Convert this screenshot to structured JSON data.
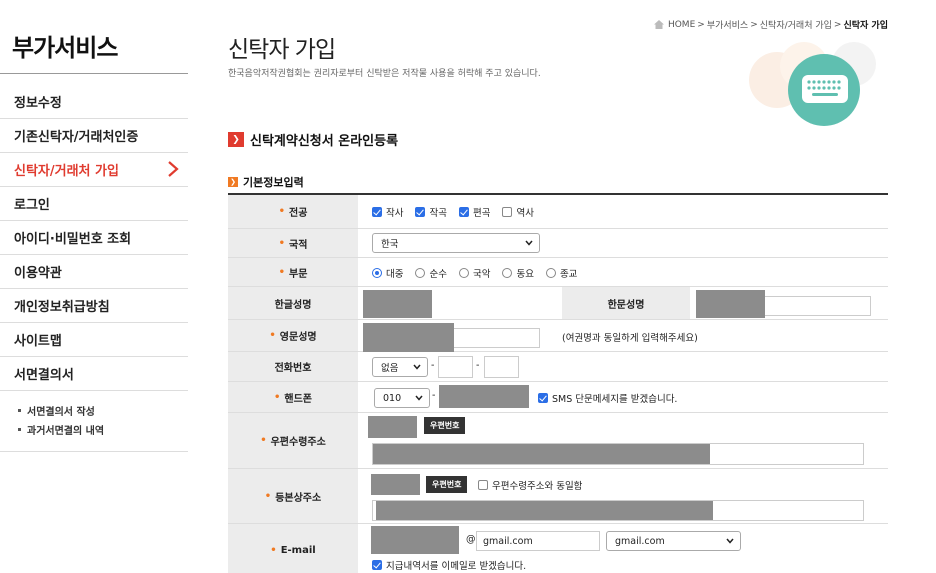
{
  "sidebar": {
    "title": "부가서비스",
    "items": [
      {
        "label": "정보수정"
      },
      {
        "label": "기존신탁자/거래처인증"
      },
      {
        "label": "신탁자/거래처 가입"
      },
      {
        "label": "로그인"
      },
      {
        "label": "아이디·비밀번호 조회"
      },
      {
        "label": "이용약관"
      },
      {
        "label": "개인정보취급방침"
      },
      {
        "label": "사이트맵"
      },
      {
        "label": "서면결의서"
      }
    ],
    "active_index": 2,
    "sub_items": [
      {
        "label": "서면결의서 작성"
      },
      {
        "label": "과거서면결의 내역"
      }
    ]
  },
  "breadcrumb": {
    "home": "HOME",
    "sep": ">",
    "level1": "부가서비스",
    "level2": "신탁자/거래처 가입",
    "current": "신탁자 가입"
  },
  "page": {
    "title": "신탁자 가입",
    "description": "한국음악저작권협회는 권리자로부터 신탁받은 저작물 사용을 허락해 주고 있습니다."
  },
  "section": {
    "title": "신탁계약신청서 온라인등록",
    "subtitle": "기본정보입력"
  },
  "form": {
    "genre": {
      "label": "전공",
      "options": [
        {
          "label": "작사",
          "checked": true
        },
        {
          "label": "작곡",
          "checked": true
        },
        {
          "label": "편곡",
          "checked": true
        },
        {
          "label": "역사",
          "checked": false
        }
      ]
    },
    "nationality": {
      "label": "국적",
      "value": "한국"
    },
    "category": {
      "label": "부문",
      "options": [
        {
          "label": "대중",
          "selected": true
        },
        {
          "label": "순수",
          "selected": false
        },
        {
          "label": "국악",
          "selected": false
        },
        {
          "label": "동요",
          "selected": false
        },
        {
          "label": "종교",
          "selected": false
        }
      ]
    },
    "korean_name": {
      "label": "한글성명"
    },
    "hanja_name": {
      "label": "한문성명"
    },
    "english_name": {
      "label": "영문성명",
      "note": "(여권명과 동일하게 입력해주세요)"
    },
    "phone": {
      "label": "전화번호",
      "prefix": "없음",
      "dash": "-"
    },
    "mobile": {
      "label": "핸드폰",
      "prefix": "010",
      "dash": "-",
      "sms_label": "SMS 단문메세지를 받겠습니다.",
      "sms_checked": true
    },
    "mail_address": {
      "label": "우편수령주소",
      "button": "우편번호"
    },
    "registered_address": {
      "label": "등본상주소",
      "button": "우편번호",
      "same_label": "우편수령주소와 동일함",
      "same_checked": false
    },
    "email": {
      "label": "E-mail",
      "at": "@",
      "domain_value": "gmail.com",
      "domain_select": "gmail.com",
      "statement_label": "지급내역서를 이메일로 받겠습니다.",
      "statement_checked": true
    }
  },
  "colors": {
    "accent_red": "#e03b2f",
    "accent_orange": "#f07a23",
    "check_blue": "#2b6ee6",
    "label_bg": "#ececec",
    "icon_teal": "#5fbfb0"
  }
}
